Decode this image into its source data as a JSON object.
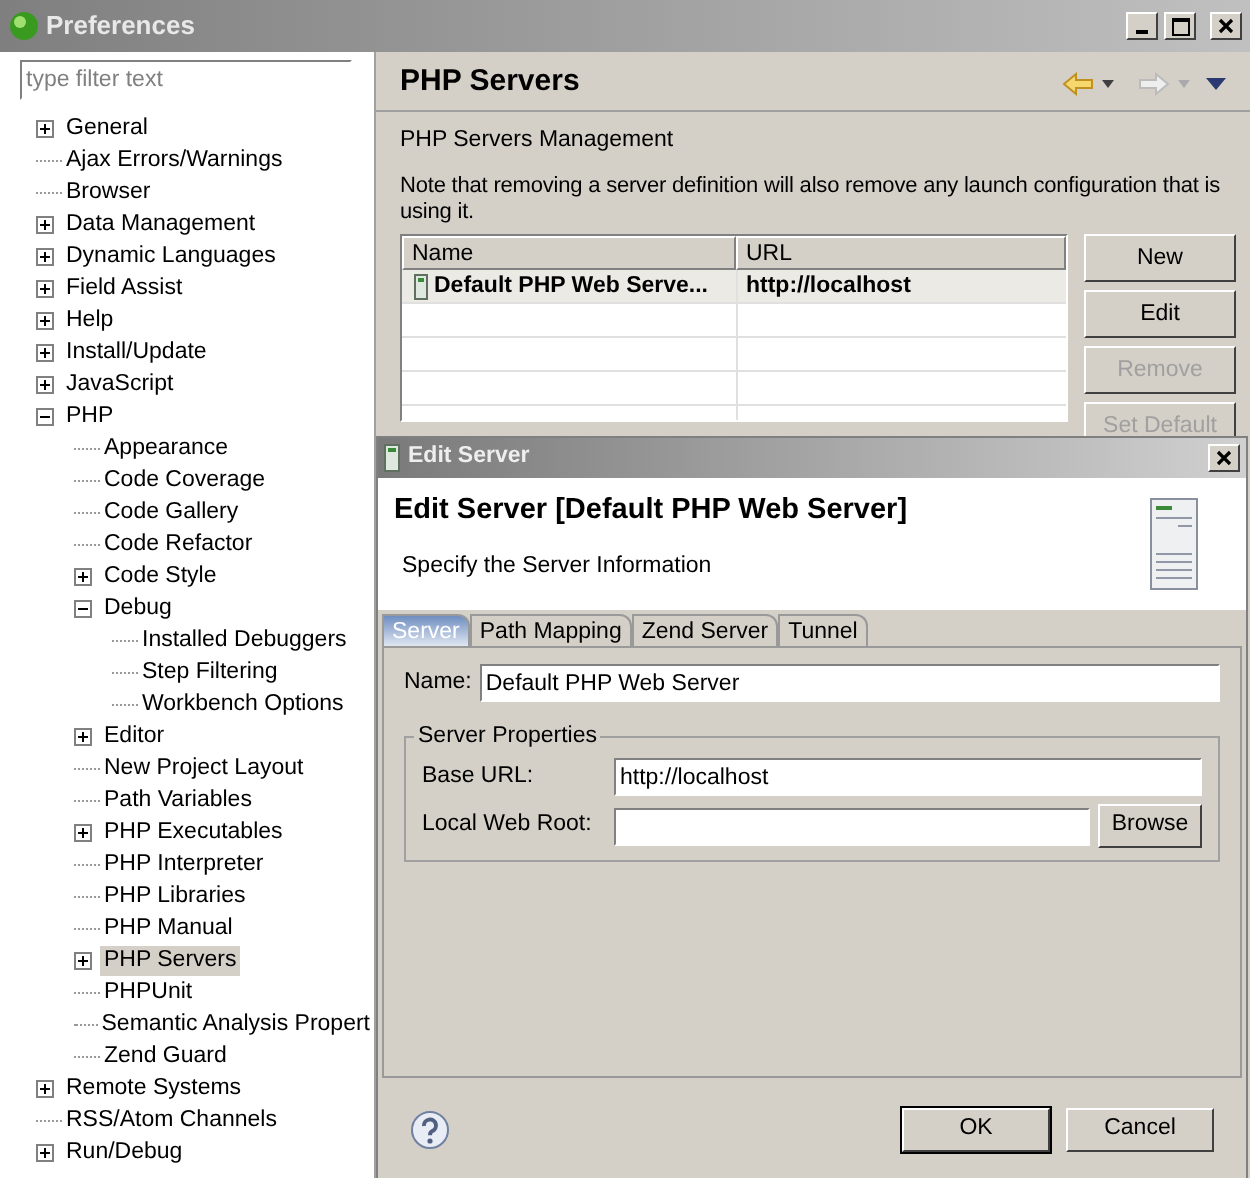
{
  "window": {
    "title": "Preferences"
  },
  "sidebar": {
    "filter": {
      "placeholder": "type filter text"
    },
    "tree": [
      {
        "label": "General",
        "expanded": false,
        "selected": false
      },
      {
        "label": "Ajax Errors/Warnings",
        "selected": false
      },
      {
        "label": "Browser",
        "selected": false
      },
      {
        "label": "Data Management",
        "expanded": false,
        "selected": false
      },
      {
        "label": "Dynamic Languages",
        "expanded": false,
        "selected": false
      },
      {
        "label": "Field Assist",
        "expanded": false,
        "selected": false
      },
      {
        "label": "Help",
        "expanded": false,
        "selected": false
      },
      {
        "label": "Install/Update",
        "expanded": false,
        "selected": false
      },
      {
        "label": "JavaScript",
        "expanded": false,
        "selected": false
      },
      {
        "label": "PHP",
        "expanded": true,
        "selected": false,
        "children": [
          {
            "label": "Appearance",
            "selected": false
          },
          {
            "label": "Code Coverage",
            "selected": false
          },
          {
            "label": "Code Gallery",
            "selected": false
          },
          {
            "label": "Code Refactor",
            "selected": false
          },
          {
            "label": "Code Style",
            "expanded": false,
            "selected": false
          },
          {
            "label": "Debug",
            "expanded": true,
            "selected": false,
            "children": [
              {
                "label": "Installed Debuggers",
                "selected": false
              },
              {
                "label": "Step Filtering",
                "selected": false
              },
              {
                "label": "Workbench Options",
                "selected": false
              }
            ]
          },
          {
            "label": "Editor",
            "expanded": false,
            "selected": false
          },
          {
            "label": "New Project Layout",
            "selected": false
          },
          {
            "label": "Path Variables",
            "selected": false
          },
          {
            "label": "PHP Executables",
            "expanded": false,
            "selected": false
          },
          {
            "label": "PHP Interpreter",
            "selected": false
          },
          {
            "label": "PHP Libraries",
            "selected": false
          },
          {
            "label": "PHP Manual",
            "selected": false
          },
          {
            "label": "PHP Servers",
            "expanded": false,
            "selected": true
          },
          {
            "label": "PHPUnit",
            "selected": false
          },
          {
            "label": "Semantic Analysis Propert",
            "selected": false
          },
          {
            "label": "Zend Guard",
            "selected": false
          }
        ]
      },
      {
        "label": "Remote Systems",
        "expanded": false,
        "selected": false
      },
      {
        "label": "RSS/Atom Channels",
        "selected": false
      },
      {
        "label": "Run/Debug",
        "expanded": false,
        "selected": false
      }
    ]
  },
  "page": {
    "title": "PHP Servers",
    "subtitle": "PHP Servers Management",
    "note": "Note that removing a server definition will also remove any launch configuration that is using it.",
    "table": {
      "columns": [
        "Name",
        "URL"
      ],
      "rows": [
        {
          "name": "Default PHP Web Serve...",
          "url": "http://localhost",
          "selected": true
        }
      ]
    },
    "buttons": [
      {
        "label": "New",
        "disabled": false
      },
      {
        "label": "Edit",
        "disabled": false
      },
      {
        "label": "Remove",
        "disabled": true
      },
      {
        "label": "Set Default",
        "disabled": true
      }
    ]
  },
  "dialog": {
    "title": "Edit Server",
    "heading": "Edit Server [Default PHP Web Server]",
    "description": "Specify the Server Information",
    "tabs": [
      {
        "label": "Server",
        "selected": true
      },
      {
        "label": "Path Mapping",
        "selected": false
      },
      {
        "label": "Zend Server",
        "selected": false
      },
      {
        "label": "Tunnel",
        "selected": false
      }
    ],
    "name_field": {
      "label": "Name:",
      "value": "Default PHP Web Server"
    },
    "group": {
      "title": "Server Properties",
      "fields": [
        {
          "label": "Base URL:",
          "value": "http://localhost"
        },
        {
          "label": "Local Web Root:",
          "button": "Browse"
        }
      ]
    },
    "buttons": [
      {
        "label": "OK",
        "default": true
      },
      {
        "label": "Cancel",
        "default": false
      }
    ]
  }
}
